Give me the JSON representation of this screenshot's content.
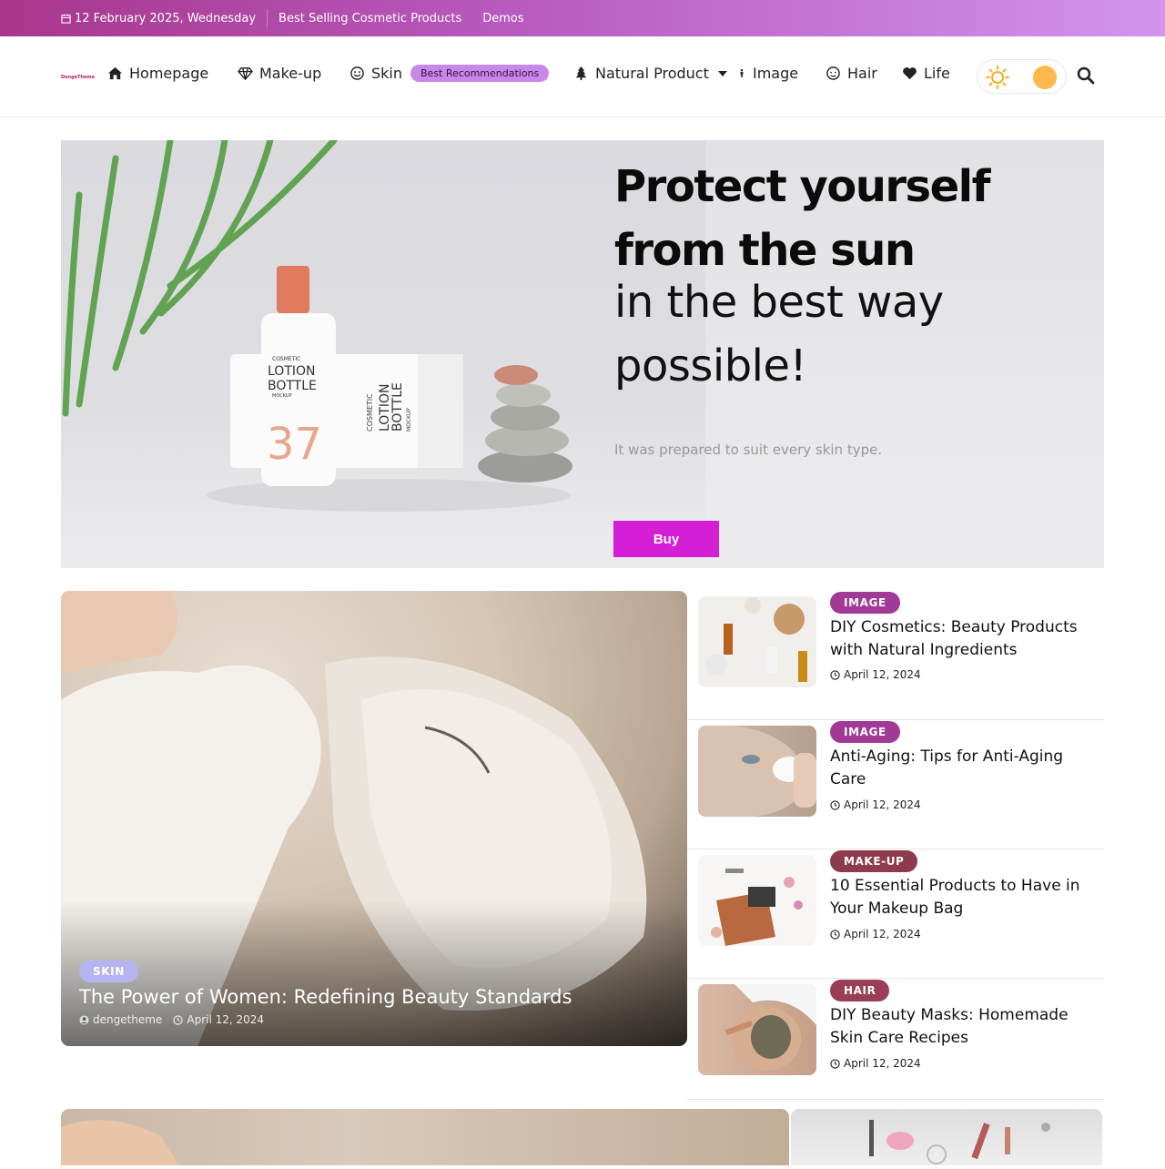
{
  "topbar": {
    "date": "12 February 2025, Wednesday",
    "links": [
      "Best Selling Cosmetic Products",
      "Demos"
    ]
  },
  "header": {
    "logo": "DengeTheme",
    "nav": [
      {
        "label": "Homepage",
        "icon": "home-icon"
      },
      {
        "label": "Make-up",
        "icon": "diamond-icon"
      },
      {
        "label": "Skin",
        "icon": "smile-icon",
        "badge": "Best Recommendations"
      },
      {
        "label": "Natural Product",
        "icon": "tree-icon",
        "dropdown": true
      },
      {
        "label": "Image",
        "icon": "person-icon"
      },
      {
        "label": "Hair",
        "icon": "face-icon"
      },
      {
        "label": "Life",
        "icon": "heart-icon"
      }
    ]
  },
  "hero": {
    "title": "Protect yourself from the sun",
    "subtitle": "in the best way possible!",
    "description": "It was prepared to suit every skin type.",
    "button": "Buy",
    "product_text": {
      "line1": "COSMETIC",
      "line2": "LOTION",
      "line3": "BOTTLE",
      "line4": "MOCKUP",
      "number": "37"
    }
  },
  "featured": {
    "tag": "SKIN",
    "title": "The Power of Women: Redefining Beauty Standards",
    "author": "dengetheme",
    "date": "April 12, 2024"
  },
  "posts": [
    {
      "tag": "IMAGE",
      "tag_color": "#a03a96",
      "title": "DIY Cosmetics: Beauty Products with Natural Ingredients",
      "date": "April 12, 2024"
    },
    {
      "tag": "IMAGE",
      "tag_color": "#a03a96",
      "title": "Anti-Aging: Tips for Anti-Aging Care",
      "date": "April 12, 2024"
    },
    {
      "tag": "MAKE-UP",
      "tag_color": "#8e3b4d",
      "title": "10 Essential Products to Have in Your Makeup Bag",
      "date": "April 12, 2024"
    },
    {
      "tag": "HAIR",
      "tag_color": "#9a3d56",
      "title": "DIY Beauty Masks: Homemade Skin Care Recipes",
      "date": "April 12, 2024"
    }
  ],
  "colors": {
    "accent": "#d41fd7",
    "topbar_start": "#a8368c",
    "topbar_end": "#d394ec"
  }
}
